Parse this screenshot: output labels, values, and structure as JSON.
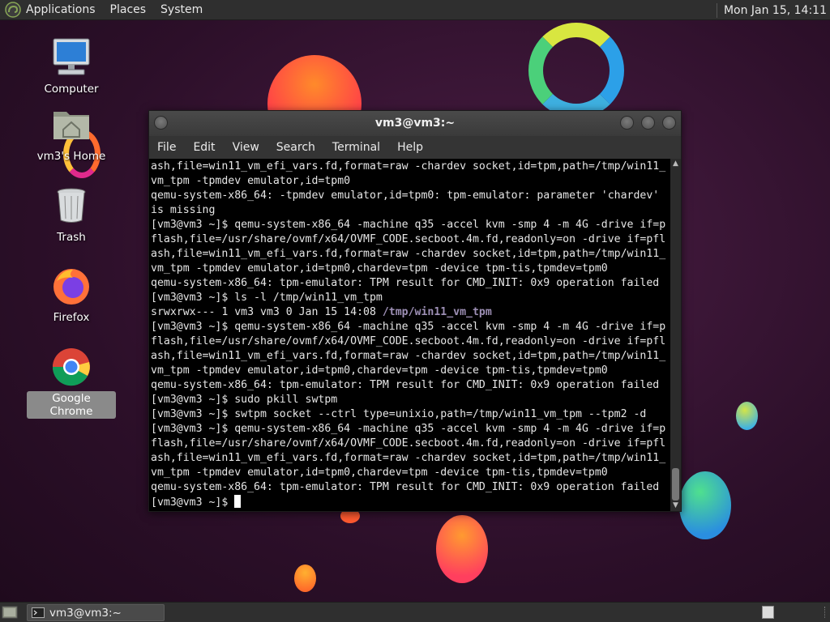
{
  "top_panel": {
    "menus": [
      "Applications",
      "Places",
      "System"
    ],
    "clock": "Mon Jan 15, 14:11"
  },
  "desktop": {
    "icons": [
      {
        "label": "Computer"
      },
      {
        "label": "vm3's Home"
      },
      {
        "label": "Trash"
      },
      {
        "label": "Firefox"
      },
      {
        "label": "Google Chrome"
      }
    ]
  },
  "terminal": {
    "title": "vm3@vm3:~",
    "menu": [
      "File",
      "Edit",
      "View",
      "Search",
      "Terminal",
      "Help"
    ],
    "lines": [
      "ash,file=win11_vm_efi_vars.fd,format=raw -chardev socket,id=tpm,path=/tmp/win11_",
      "vm_tpm -tpmdev emulator,id=tpm0",
      "qemu-system-x86_64: -tpmdev emulator,id=tpm0: tpm-emulator: parameter 'chardev'",
      "is missing",
      "[vm3@vm3 ~]$ qemu-system-x86_64 -machine q35 -accel kvm -smp 4 -m 4G -drive if=p",
      "flash,file=/usr/share/ovmf/x64/OVMF_CODE.secboot.4m.fd,readonly=on -drive if=pfl",
      "ash,file=win11_vm_efi_vars.fd,format=raw -chardev socket,id=tpm,path=/tmp/win11_",
      "vm_tpm -tpmdev emulator,id=tpm0,chardev=tpm -device tpm-tis,tpmdev=tpm0",
      "qemu-system-x86_64: tpm-emulator: TPM result for CMD_INIT: 0x9 operation failed",
      "[vm3@vm3 ~]$ ls -l /tmp/win11_vm_tpm",
      "srwxrwx--- 1 vm3 vm3 0 Jan 15 14:08 ",
      "[vm3@vm3 ~]$ qemu-system-x86_64 -machine q35 -accel kvm -smp 4 -m 4G -drive if=p",
      "flash,file=/usr/share/ovmf/x64/OVMF_CODE.secboot.4m.fd,readonly=on -drive if=pfl",
      "ash,file=win11_vm_efi_vars.fd,format=raw -chardev socket,id=tpm,path=/tmp/win11_",
      "vm_tpm -tpmdev emulator,id=tpm0,chardev=tpm -device tpm-tis,tpmdev=tpm0",
      "qemu-system-x86_64: tpm-emulator: TPM result for CMD_INIT: 0x9 operation failed",
      "[vm3@vm3 ~]$ sudo pkill swtpm",
      "[vm3@vm3 ~]$ swtpm socket --ctrl type=unixio,path=/tmp/win11_vm_tpm --tpm2 -d",
      "[vm3@vm3 ~]$ qemu-system-x86_64 -machine q35 -accel kvm -smp 4 -m 4G -drive if=p",
      "flash,file=/usr/share/ovmf/x64/OVMF_CODE.secboot.4m.fd,readonly=on -drive if=pfl",
      "ash,file=win11_vm_efi_vars.fd,format=raw -chardev socket,id=tpm,path=/tmp/win11_",
      "vm_tpm -tpmdev emulator,id=tpm0,chardev=tpm -device tpm-tis,tpmdev=tpm0",
      "qemu-system-x86_64: tpm-emulator: TPM result for CMD_INIT: 0x9 operation failed",
      "[vm3@vm3 ~]$ "
    ],
    "highlighted_path": "/tmp/win11_vm_tpm"
  },
  "bottom_panel": {
    "tasks": [
      {
        "label": "vm3@vm3:~"
      }
    ]
  }
}
